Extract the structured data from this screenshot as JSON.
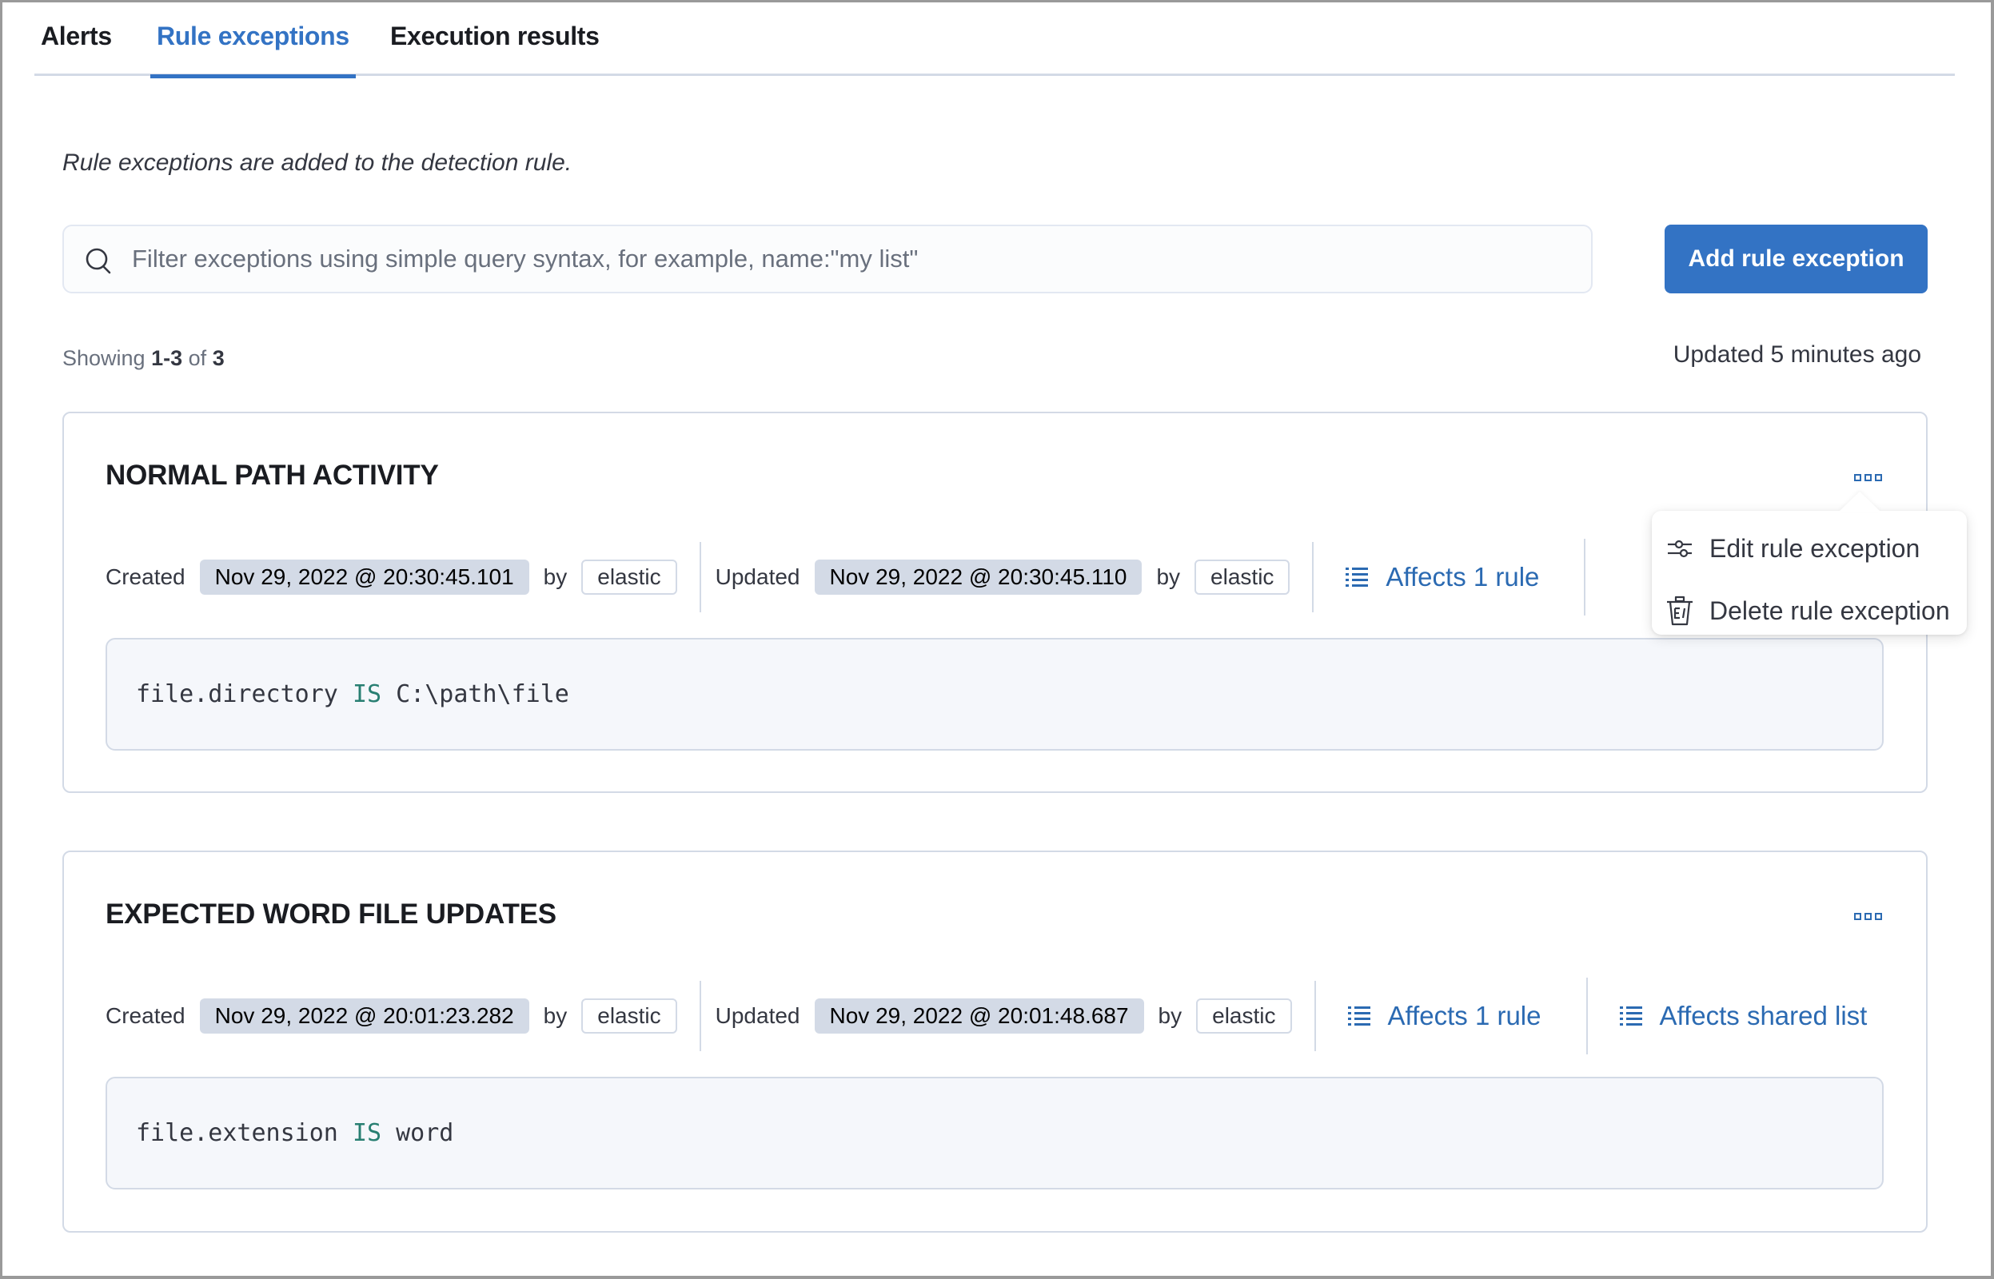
{
  "tabs": [
    {
      "label": "Alerts",
      "active": false
    },
    {
      "label": "Rule exceptions",
      "active": true
    },
    {
      "label": "Execution results",
      "active": false
    }
  ],
  "description": "Rule exceptions are added to the detection rule.",
  "search": {
    "placeholder": "Filter exceptions using simple query syntax, for example, name:\"my list\"",
    "value": "",
    "icon": "search-icon"
  },
  "add_button_label": "Add rule exception",
  "showing": {
    "prefix": "Showing",
    "range": "1-3",
    "of": "of",
    "total": "3"
  },
  "updated_ago": {
    "prefix": "Updated",
    "value": "5 minutes ago"
  },
  "labels": {
    "created": "Created",
    "updated": "Updated",
    "by": "by"
  },
  "exceptions": [
    {
      "title": "NORMAL PATH ACTIVITY",
      "created_at": "Nov 29, 2022 @ 20:30:45.101",
      "created_by": "elastic",
      "updated_at": "Nov 29, 2022 @ 20:30:45.110",
      "updated_by": "elastic",
      "affects": [
        "Affects 1 rule"
      ],
      "condition": {
        "field": "file.directory",
        "operator": "IS",
        "value": "C:\\path\\file"
      },
      "menu_open": true
    },
    {
      "title": "EXPECTED WORD FILE UPDATES",
      "created_at": "Nov 29, 2022 @ 20:01:23.282",
      "created_by": "elastic",
      "updated_at": "Nov 29, 2022 @ 20:01:48.687",
      "updated_by": "elastic",
      "affects": [
        "Affects 1 rule",
        "Affects shared list"
      ],
      "condition": {
        "field": "file.extension",
        "operator": "IS",
        "value": "word"
      },
      "menu_open": false
    }
  ],
  "context_menu": {
    "items": [
      {
        "label": "Edit rule exception",
        "icon": "sliders-icon"
      },
      {
        "label": "Delete rule exception",
        "icon": "trash-icon"
      }
    ]
  },
  "colors": {
    "primary": "#3373c4",
    "link": "#2b6ab2",
    "operator": "#287f72",
    "badge_bg": "#d3dae6",
    "code_bg": "#f5f7fb"
  }
}
